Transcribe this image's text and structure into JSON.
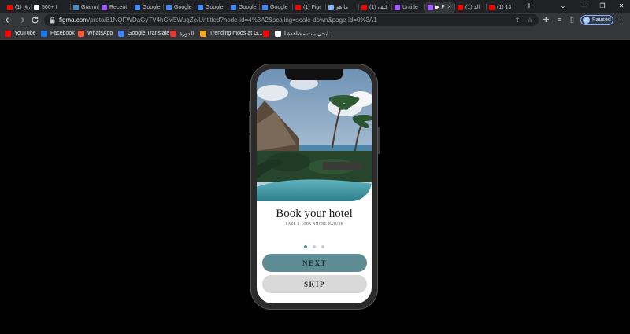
{
  "browser": {
    "tabs": [
      {
        "label": "طرق (1)",
        "icon": "youtube-icon",
        "color": "#ff0000"
      },
      {
        "label": "500+ I",
        "icon": "site-icon",
        "color": "#ffffff"
      },
      {
        "label": "Gramm",
        "icon": "python-icon",
        "color": "#4b8bbe"
      },
      {
        "label": "Recent",
        "icon": "figma-icon",
        "color": "#a259ff"
      },
      {
        "label": "Google",
        "icon": "google-translate-icon",
        "color": "#4285f4"
      },
      {
        "label": "Google",
        "icon": "google-translate-icon",
        "color": "#4285f4"
      },
      {
        "label": "Google",
        "icon": "google-translate-icon",
        "color": "#4285f4"
      },
      {
        "label": "Google",
        "icon": "google-translate-icon",
        "color": "#4285f4"
      },
      {
        "label": "Google",
        "icon": "google-translate-icon",
        "color": "#4285f4"
      },
      {
        "label": "(1) Figr",
        "icon": "youtube-icon",
        "color": "#ff0000"
      },
      {
        "label": "ما هو",
        "icon": "google-icon",
        "color": "#8ab4f8"
      },
      {
        "label": "(1) كيف",
        "icon": "youtube-icon",
        "color": "#ff0000"
      },
      {
        "label": "Untitle",
        "icon": "figma-icon",
        "color": "#a259ff"
      },
      {
        "label": "▶ F",
        "icon": "figma-icon",
        "color": "#a259ff"
      },
      {
        "label": "(1) الد",
        "icon": "youtube-icon",
        "color": "#ff0000"
      },
      {
        "label": "(1) 13",
        "icon": "youtube-icon",
        "color": "#ff0000"
      }
    ],
    "new_tab": "+",
    "window_controls": [
      "⌄",
      "—",
      "❐",
      "✕"
    ],
    "url_domain": "figma.com",
    "url_path": "/proto/81NQFWDaGyTV4hCM5WuqZe/Untitled?node-id=4%3A2&scaling=scale-down&page-id=0%3A1",
    "profile_label": "Paused",
    "bookmarks": [
      {
        "label": "YouTube",
        "icon": "youtube-icon",
        "color": "#ff0000"
      },
      {
        "label": "Facebook",
        "icon": "facebook-icon",
        "color": "#1877f2"
      },
      {
        "label": "WhatsApp",
        "icon": "whatsapp-icon",
        "color": "#ff5a36"
      },
      {
        "label": "Google Translate",
        "icon": "google-translate-icon",
        "color": "#4285f4"
      },
      {
        "label": "الدورة",
        "icon": "gear-icon",
        "color": "#e53935"
      },
      {
        "label": "Trending mods at G...",
        "icon": "mods-icon",
        "color": "#f9a825"
      },
      {
        "label": "",
        "icon": "youtube-icon",
        "color": "#ff0000"
      },
      {
        "label": "ابحي بنت مشاهدة ا...",
        "icon": "page-icon",
        "color": "#ffffff"
      }
    ]
  },
  "app": {
    "title": "Book your hotel",
    "subtitle": "Take a look among nature",
    "page_indicator": {
      "total": 3,
      "active": 0
    },
    "next_label": "NEXT",
    "skip_label": "SKIP",
    "colors": {
      "primary": "#5e8c94",
      "secondary": "#d9d9d9",
      "dot_active": "#5e8c94",
      "dot_inactive": "#c9cfd1"
    }
  }
}
